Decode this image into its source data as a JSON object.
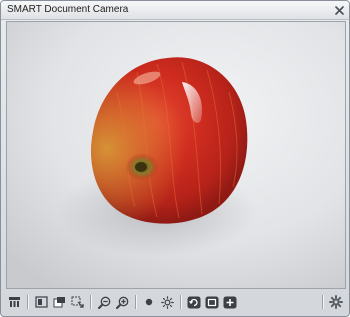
{
  "window": {
    "title": "SMART Document Camera"
  },
  "titlebar": {
    "close_icon": "close-icon"
  },
  "viewport": {
    "content": "camera feed",
    "subject": "apple-photo"
  },
  "toolbar": {
    "groups": [
      [
        "camera-select-icon"
      ],
      [
        "freeze-icon",
        "capture-icon",
        "capture-region-icon"
      ],
      [
        "zoom-out-icon",
        "zoom-in-icon"
      ],
      [
        "focus-icon",
        "brightness-icon"
      ],
      [
        "rotate-icon",
        "fit-screen-icon",
        "add-icon"
      ]
    ],
    "settings_icon": "gear-icon"
  },
  "colors": {
    "window_bg": "#d3d7dc",
    "icon_dark": "#3c4047",
    "apple_red": "#c0261c"
  }
}
